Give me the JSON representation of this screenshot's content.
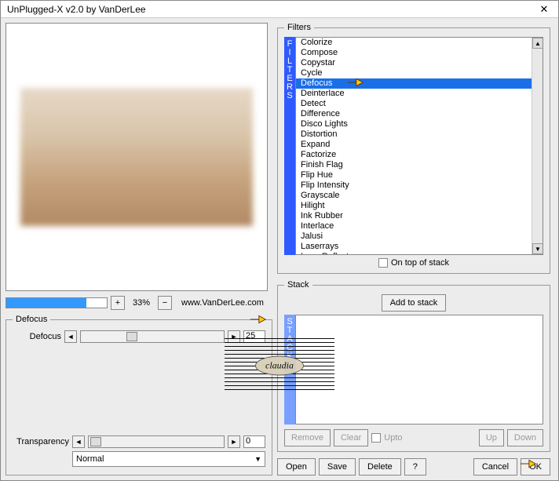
{
  "window": {
    "title": "UnPlugged-X v2.0 by VanDerLee"
  },
  "zoom": {
    "percent": "33%",
    "link": "www.VanDerLee.com"
  },
  "param_group": {
    "legend": "Defocus",
    "label": "Defocus",
    "value": "25"
  },
  "transparency": {
    "label": "Transparency",
    "value": "0",
    "mode": "Normal"
  },
  "filters": {
    "legend": "Filters",
    "tab": [
      "F",
      "I",
      "L",
      "T",
      "E",
      "R",
      "S"
    ],
    "items": [
      "Colorize",
      "Compose",
      "Copystar",
      "Cycle",
      "Defocus",
      "Deinterlace",
      "Detect",
      "Difference",
      "Disco Lights",
      "Distortion",
      "Expand",
      "Factorize",
      "Finish Flag",
      "Flip Hue",
      "Flip Intensity",
      "Grayscale",
      "Hilight",
      "Ink Rubber",
      "Interlace",
      "Jalusi",
      "Laserrays",
      "Lens Reflect"
    ],
    "selected_index": 4,
    "ontop_label": "On top of stack"
  },
  "stack": {
    "legend": "Stack",
    "tab": [
      "S",
      "T",
      "A",
      "C",
      "K"
    ],
    "add": "Add to stack",
    "remove": "Remove",
    "clear": "Clear",
    "upto": "Upto",
    "up": "Up",
    "down": "Down"
  },
  "buttons": {
    "open": "Open",
    "save": "Save",
    "delete": "Delete",
    "help": "?",
    "cancel": "Cancel",
    "ok": "OK"
  },
  "watermark": "claudia"
}
